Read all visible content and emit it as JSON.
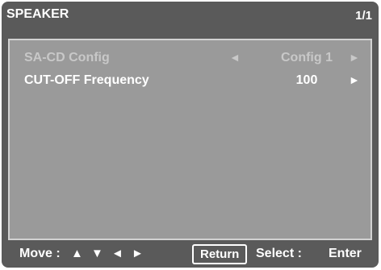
{
  "header": {
    "title": "SPEAKER",
    "page": "1/1"
  },
  "settings": [
    {
      "label": "SA-CD Config",
      "left_arrow": "◄",
      "value": "Config 1",
      "right_arrow": "►",
      "state": "disabled"
    },
    {
      "label": "CUT-OFF Frequency",
      "left_arrow": "",
      "value": "100",
      "right_arrow": "►",
      "state": "active"
    }
  ],
  "footer": {
    "move_label": "Move :",
    "move_arrows": "▲ ▼ ◄ ►",
    "return_label": "Return",
    "select_label": "Select :",
    "enter_label": "Enter"
  },
  "colors": {
    "frame": "#5a5a5a",
    "panel": "#9a9a9a",
    "panel_border": "#d2d2d2",
    "active_text": "#ffffff",
    "disabled_text": "#c8c8c8"
  }
}
